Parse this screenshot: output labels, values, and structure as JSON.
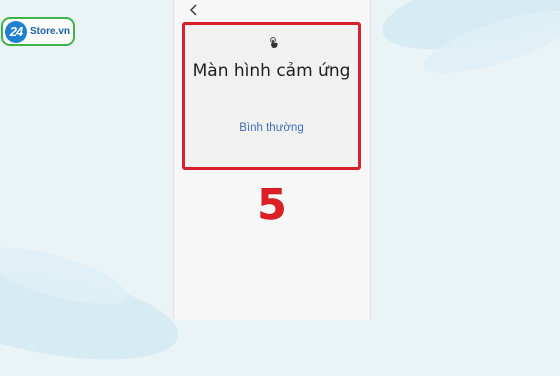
{
  "brand": {
    "logo_number": "24",
    "logo_text": "Store.vn"
  },
  "screen": {
    "back_icon": "chevron-left-icon",
    "card": {
      "icon": "touch-pointer-icon",
      "title": "Màn hình cảm ứng",
      "status": "Bình thường"
    },
    "step_number": "5"
  },
  "colors": {
    "highlight_border": "#d8202a",
    "status_text": "#3f6fb5",
    "step_number": "#e01e26",
    "logo_border": "#3cb44a",
    "logo_blue": "#1f7fd0"
  }
}
